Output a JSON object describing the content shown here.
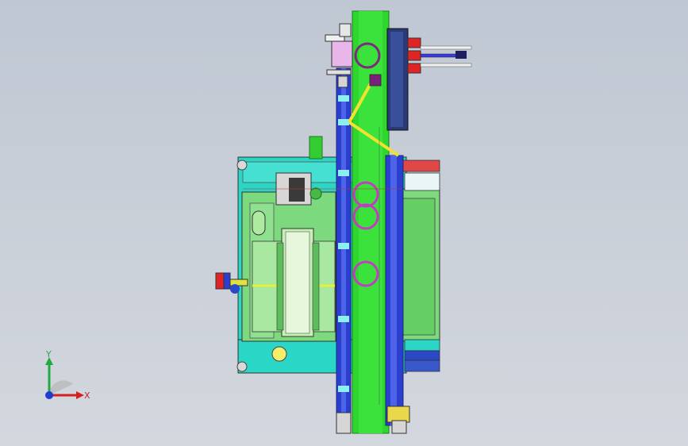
{
  "viewport": {
    "background_top": "#bfc7d3",
    "background_bottom": "#d3d7de"
  },
  "triad": {
    "x_label": "X",
    "y_label": "Y",
    "x_color": "#d32020",
    "y_color": "#22a844",
    "z_color": "#1e3bd6"
  },
  "colors": {
    "main_column": "#2ed62e",
    "blue_rail": "#2a3fd0",
    "mold_body": "#2ad6c6",
    "inner_plate": "#7dd97d",
    "light_panel": "#c7f0b5",
    "red_part": "#e02424",
    "magenta_part": "#c43bc4",
    "yellow_link": "#f2e230",
    "dark_blue_block": "#2a3a78"
  }
}
